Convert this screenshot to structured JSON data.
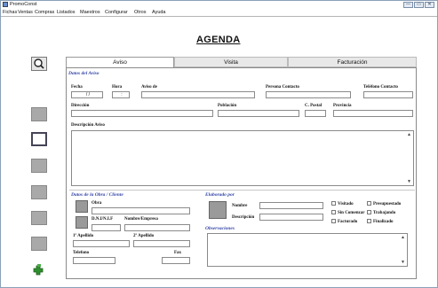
{
  "window": {
    "title": "PromoConst",
    "controls": [
      "—",
      "▭",
      "✕"
    ]
  },
  "menu": [
    "Fichas",
    "Ventas",
    "Compras",
    "Listados",
    "Maestros",
    "Configurar",
    "Otros",
    "Ayuda"
  ],
  "app_title": "AGENDA",
  "tabs": [
    "Aviso",
    "Visita",
    "Facturación"
  ],
  "aviso": {
    "section_title": "Datos del Aviso",
    "fecha_label": "Fecha",
    "fecha_value": "/ /",
    "hora_label": "Hora",
    "hora_value": ":",
    "aviso_de_label": "Aviso de",
    "persona_contacto_label": "Persona Contacto",
    "telefono_contacto_label": "Teléfono Contacto",
    "direccion_label": "Dirección",
    "poblacion_label": "Población",
    "cpostal_label": "C. Postal",
    "provincia_label": "Provincia",
    "descripcion_label": "Descripción Aviso"
  },
  "obra": {
    "section_title": "Datos de la Obra / Cliente",
    "obra_label": "Obra",
    "dni_label": "D.N.I/N.I.F",
    "nombre_empresa_label": "Nombre/Empresa",
    "apellido1_label": "1º Apellido",
    "apellido2_label": "2º Apellido",
    "telefono_label": "Telefono",
    "fax_label": "Fax"
  },
  "elaborado": {
    "section_title": "Elaborado por",
    "nombre_label": "Nombre",
    "descripcion_label": "Descripción"
  },
  "estado": {
    "visitado": "Visitado",
    "presupuestado": "Presupuestado",
    "sin_comenzar": "Sin Comenzar",
    "trabajando": "Trabajando",
    "facturado": "Facturado",
    "finalizado": "Finalizado"
  },
  "observaciones_label": "Observaciones",
  "scroll": {
    "up": "▲",
    "down": "▼"
  },
  "icons": {
    "search": "magnifier-icon",
    "sidebar": "folder-icon",
    "upload": "puzzle-icon"
  }
}
